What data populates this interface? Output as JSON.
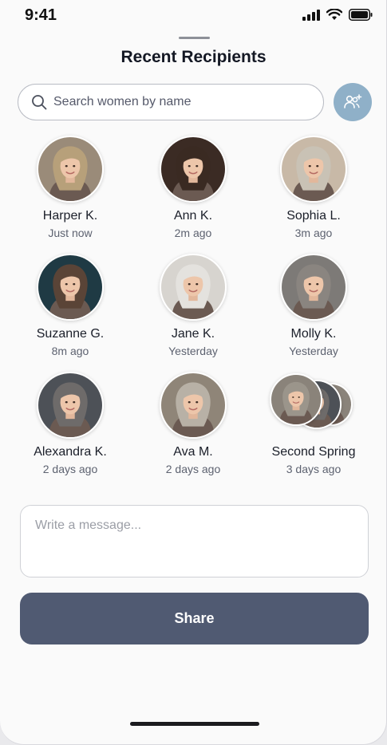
{
  "status_bar": {
    "time": "9:41"
  },
  "sheet": {
    "title": "Recent Recipients"
  },
  "search": {
    "placeholder": "Search women by name",
    "value": ""
  },
  "recipients": [
    {
      "name": "Harper K.",
      "time": "Just now",
      "hair": "#b7a07a",
      "bg": "#9a8b79"
    },
    {
      "name": "Ann K.",
      "time": "2m ago",
      "hair": "#3a2a22",
      "bg": "#3b2b24"
    },
    {
      "name": "Sophia L.",
      "time": "3m ago",
      "hair": "#c9c2b5",
      "bg": "#c8b9a7"
    },
    {
      "name": "Suzanne G.",
      "time": "8m ago",
      "hair": "#5a4437",
      "bg": "#1f3a44"
    },
    {
      "name": "Jane K.",
      "time": "Yesterday",
      "hair": "#e4e2de",
      "bg": "#d7d4cf"
    },
    {
      "name": "Molly K.",
      "time": "Yesterday",
      "hair": "#8a8580",
      "bg": "#7d7a77"
    },
    {
      "name": "Alexandra K.",
      "time": "2 days ago",
      "hair": "#6e6b6a",
      "bg": "#4d5157"
    },
    {
      "name": "Ava M.",
      "time": "2 days ago",
      "hair": "#b8b1a6",
      "bg": "#8f8578"
    },
    {
      "name": "Second Spring",
      "time": "3 days ago",
      "hair": "#9b958b",
      "bg": "#8a837a",
      "group": true
    }
  ],
  "message": {
    "placeholder": "Write a message...",
    "value": ""
  },
  "share": {
    "label": "Share"
  },
  "colors": {
    "accent": "#505a72",
    "group_button": "#8fb0c8"
  },
  "icons": {
    "search": "search-icon",
    "group": "add-group-icon",
    "signal": "cellular-signal-icon",
    "wifi": "wifi-icon",
    "battery": "battery-icon"
  }
}
